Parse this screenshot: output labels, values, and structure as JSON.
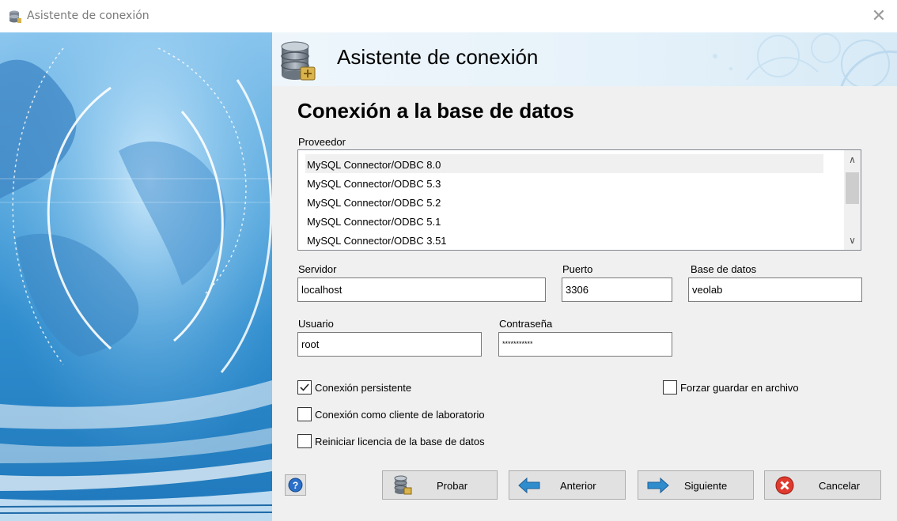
{
  "window": {
    "title": "Asistente de conexión",
    "close_glyph": "✕",
    "icon": "database-icon"
  },
  "header": {
    "title": "Asistente de conexión",
    "icon": "database-icon"
  },
  "section": {
    "title": "Conexión a la base de datos"
  },
  "provider": {
    "label": "Proveedor",
    "selected_index": 0,
    "items": [
      "MySQL Connector/ODBC 8.0",
      "MySQL Connector/ODBC 5.3",
      "MySQL Connector/ODBC 5.2",
      "MySQL Connector/ODBC 5.1",
      "MySQL Connector/ODBC 3.51"
    ],
    "scroll_up_glyph": "∧",
    "scroll_down_glyph": "∨"
  },
  "fields": {
    "server_label": "Servidor",
    "server_value": "localhost",
    "port_label": "Puerto",
    "port_value": "3306",
    "database_label": "Base de datos",
    "database_value": "veolab",
    "user_label": "Usuario",
    "user_value": "root",
    "password_label": "Contraseña",
    "password_value": "***********"
  },
  "options": {
    "persistent_label": "Conexión persistente",
    "persistent_checked": true,
    "force_save_label": "Forzar guardar en archivo",
    "force_save_checked": false,
    "lab_client_label": "Conexión como cliente de laboratorio",
    "lab_client_checked": false,
    "reset_license_label": "Reiniciar licencia de la base de datos",
    "reset_license_checked": false
  },
  "buttons": {
    "help_icon": "help-icon",
    "test_label": "Probar",
    "back_label": "Anterior",
    "next_label": "Siguiente",
    "cancel_label": "Cancelar"
  },
  "colors": {
    "accent_blue": "#2f8ccd",
    "cancel_red": "#e03a2f"
  }
}
